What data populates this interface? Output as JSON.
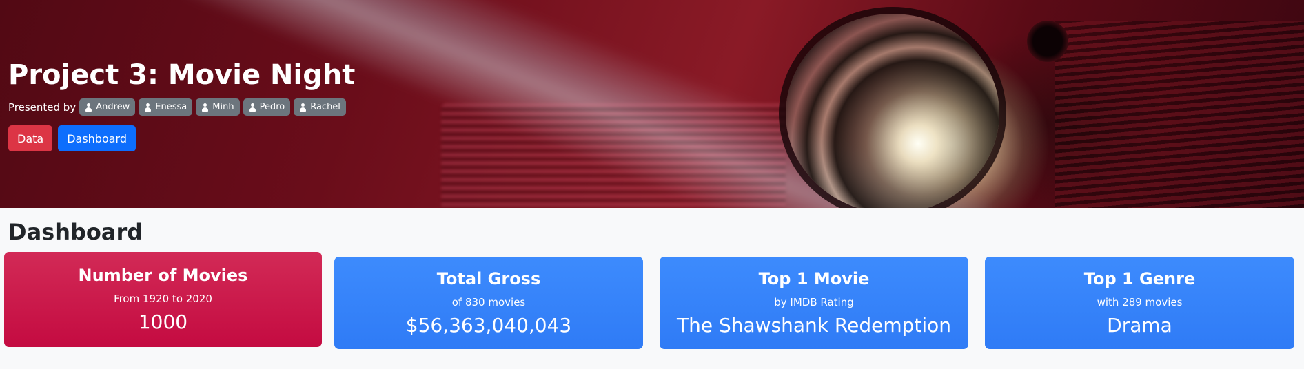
{
  "hero": {
    "title": "Project 3: Movie Night",
    "presented_by_label": "Presented by",
    "presenters": [
      "Andrew",
      "Enessa",
      "Minh",
      "Pedro",
      "Rachel"
    ],
    "buttons": {
      "data_label": "Data",
      "dashboard_label": "Dashboard"
    }
  },
  "dashboard": {
    "title": "Dashboard",
    "cards": [
      {
        "title": "Number of Movies",
        "subtitle": "From 1920 to 2020",
        "value": "1000",
        "color": "#c8114a"
      },
      {
        "title": "Total Gross",
        "subtitle": "of 830 movies",
        "value": "$56,363,040,043",
        "color": "#3884fa"
      },
      {
        "title": "Top 1 Movie",
        "subtitle": "by IMDB Rating",
        "value": "The Shawshank Redemption",
        "color": "#3884fa"
      },
      {
        "title": "Top 1 Genre",
        "subtitle": "with 289 movies",
        "value": "Drama",
        "color": "#3884fa"
      }
    ]
  },
  "colors": {
    "primary": "#0d6efd",
    "danger": "#dc3545",
    "badge": "#6c757d"
  },
  "icons": {
    "presenter_badge": "person-icon"
  }
}
